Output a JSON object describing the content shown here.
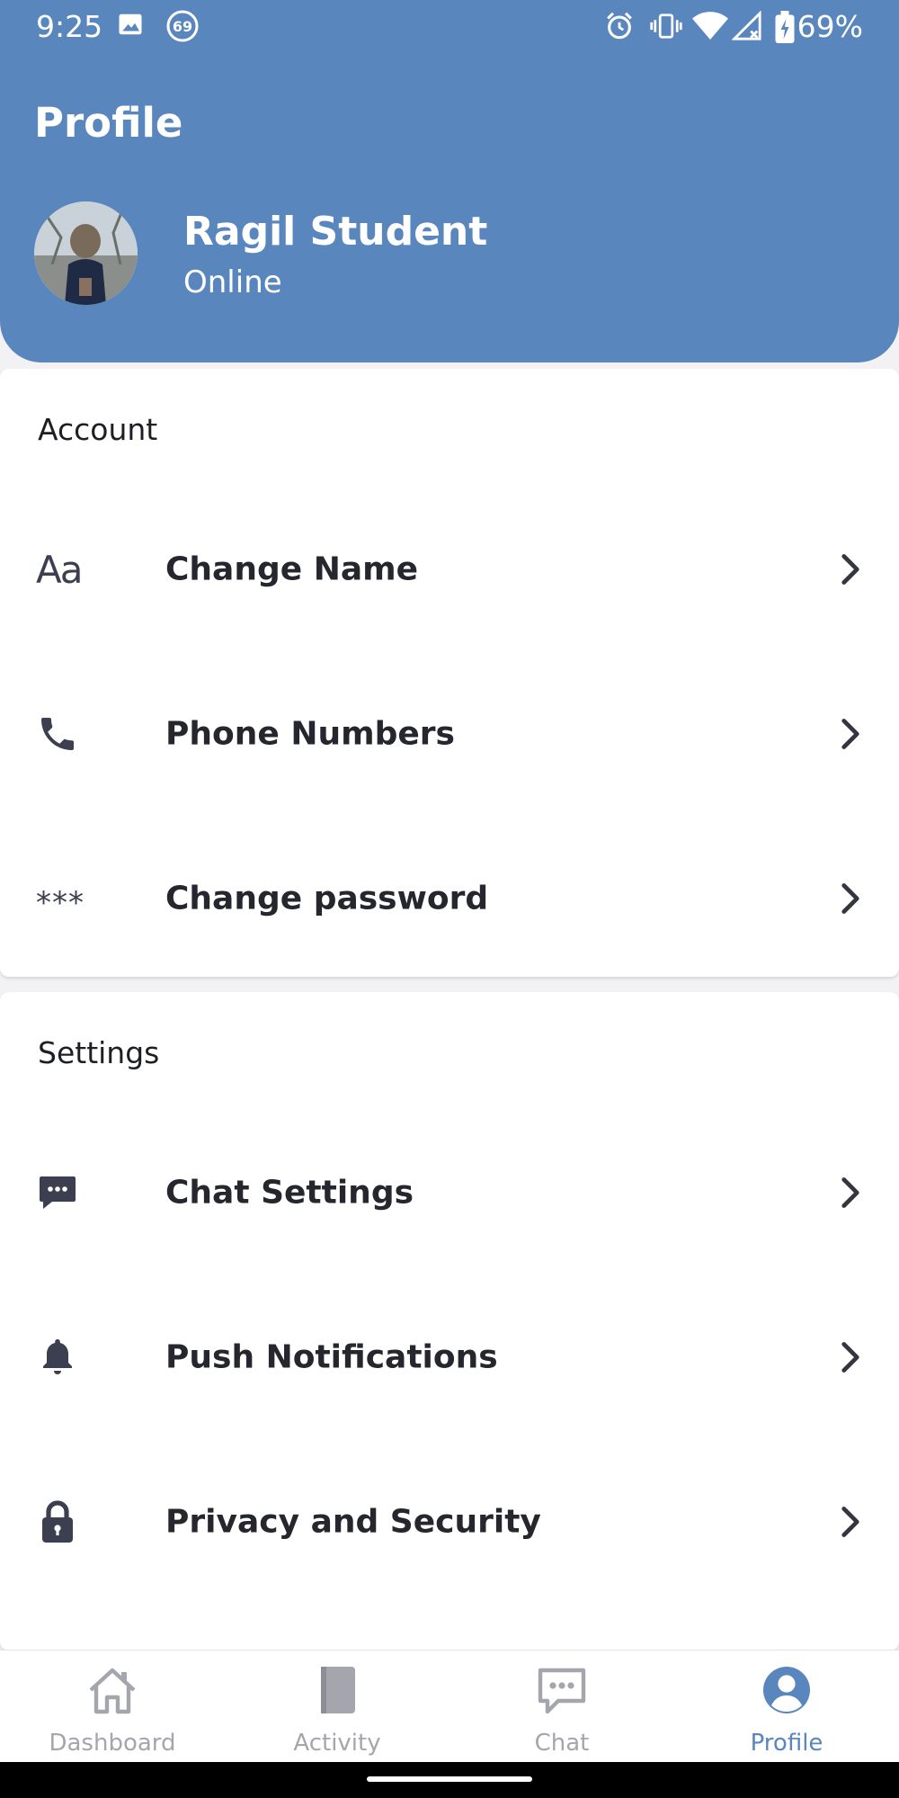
{
  "status_bar": {
    "time": "9:25",
    "notification_badge": "69",
    "battery": "69%",
    "icons": [
      "image-icon",
      "badge-69-icon",
      "alarm-icon",
      "vibrate-icon",
      "wifi-icon",
      "signal-icon",
      "battery-charging-icon"
    ]
  },
  "header": {
    "title": "Profile",
    "user_name": "Ragil Student",
    "user_status": "Online",
    "background_color": "#5a86be"
  },
  "account": {
    "title": "Account",
    "items": [
      {
        "label": "Change Name",
        "icon": "text-format-icon"
      },
      {
        "label": "Phone Numbers",
        "icon": "phone-icon"
      },
      {
        "label": "Change password",
        "icon": "password-icon"
      }
    ]
  },
  "settings": {
    "title": "Settings",
    "items": [
      {
        "label": "Chat Settings",
        "icon": "chat-bubble-icon"
      },
      {
        "label": "Push Notifications",
        "icon": "bell-icon"
      },
      {
        "label": "Privacy and Security",
        "icon": "lock-icon"
      }
    ]
  },
  "bottom_nav": {
    "items": [
      {
        "label": "Dashboard",
        "icon": "home-icon",
        "active": false
      },
      {
        "label": "Activity",
        "icon": "book-icon",
        "active": false
      },
      {
        "label": "Chat",
        "icon": "chat-icon",
        "active": false
      },
      {
        "label": "Profile",
        "icon": "user-icon",
        "active": true
      }
    ],
    "active_color": "#5a86be",
    "inactive_color": "#a5a5ad"
  }
}
